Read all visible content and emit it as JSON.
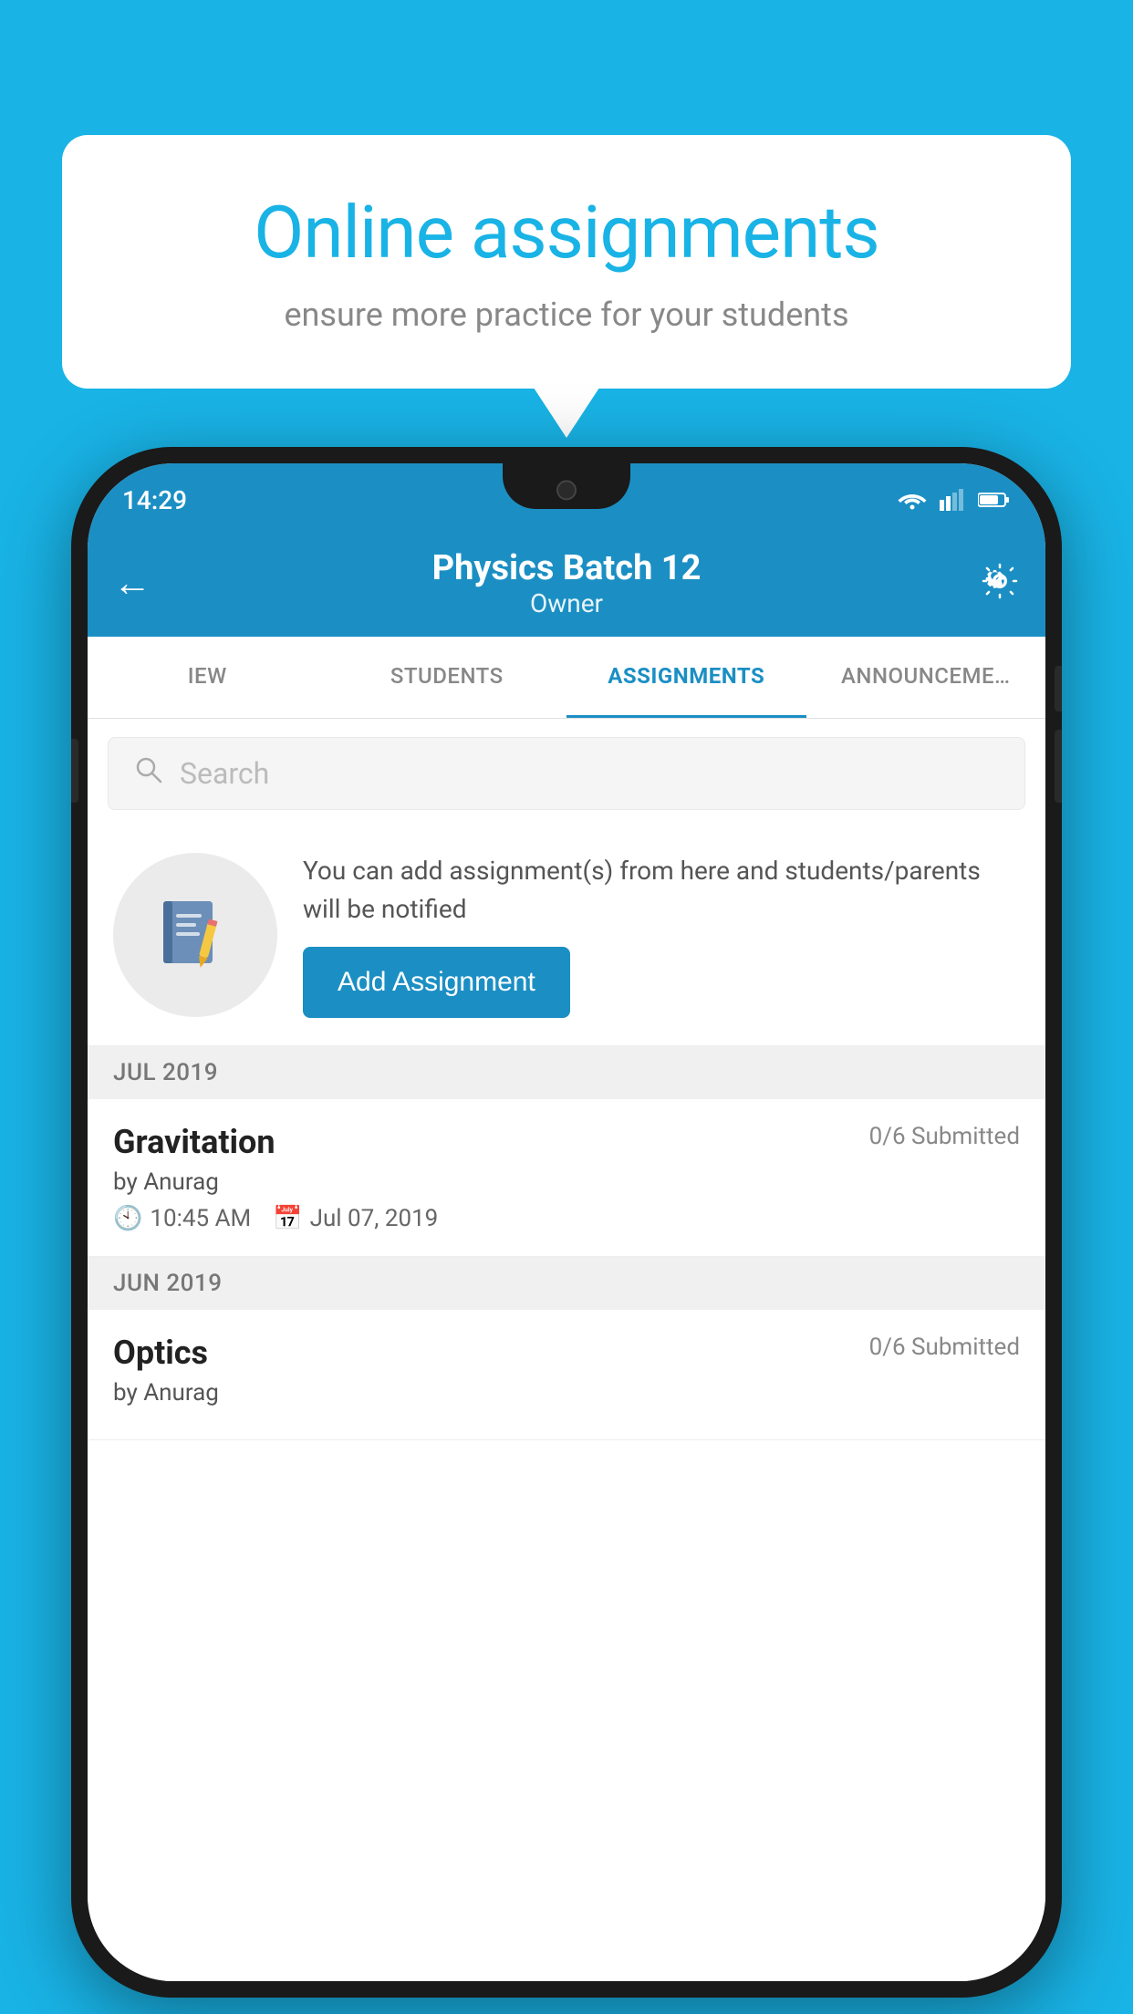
{
  "background": {
    "color": "#19b3e6"
  },
  "speech_bubble": {
    "title": "Online assignments",
    "subtitle": "ensure more practice for your students"
  },
  "phone": {
    "status_bar": {
      "time": "14:29"
    },
    "header": {
      "title": "Physics Batch 12",
      "subtitle": "Owner",
      "back_label": "←",
      "settings_label": "⚙"
    },
    "tabs": [
      {
        "label": "IEW",
        "active": false
      },
      {
        "label": "STUDENTS",
        "active": false
      },
      {
        "label": "ASSIGNMENTS",
        "active": true
      },
      {
        "label": "ANNOUNCEMENTS",
        "active": false
      }
    ],
    "search": {
      "placeholder": "Search"
    },
    "promo": {
      "text": "You can add assignment(s) from here and students/parents will be notified",
      "button_label": "Add Assignment"
    },
    "sections": [
      {
        "header": "JUL 2019",
        "assignments": [
          {
            "name": "Gravitation",
            "submitted": "0/6 Submitted",
            "by": "by Anurag",
            "time": "10:45 AM",
            "date": "Jul 07, 2019"
          }
        ]
      },
      {
        "header": "JUN 2019",
        "assignments": [
          {
            "name": "Optics",
            "submitted": "0/6 Submitted",
            "by": "by Anurag",
            "time": "",
            "date": ""
          }
        ]
      }
    ]
  }
}
